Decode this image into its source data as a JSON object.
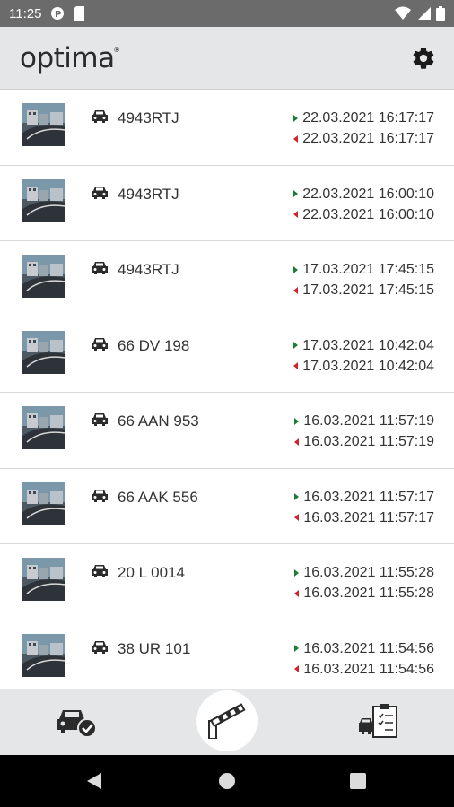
{
  "status_bar": {
    "time": "11:25"
  },
  "header": {
    "logo": "optima",
    "logo_mark": "®"
  },
  "records": [
    {
      "plate": "4943RTJ",
      "entry": "22.03.2021 16:17:17",
      "exit": "22.03.2021 16:17:17"
    },
    {
      "plate": "4943RTJ",
      "entry": "22.03.2021 16:00:10",
      "exit": "22.03.2021 16:00:10"
    },
    {
      "plate": "4943RTJ",
      "entry": "17.03.2021 17:45:15",
      "exit": "17.03.2021 17:45:15"
    },
    {
      "plate": "66 DV 198",
      "entry": "17.03.2021 10:42:04",
      "exit": "17.03.2021 10:42:04"
    },
    {
      "plate": "66 AAN 953",
      "entry": "16.03.2021 11:57:19",
      "exit": "16.03.2021 11:57:19"
    },
    {
      "plate": "66 AAK 556",
      "entry": "16.03.2021 11:57:17",
      "exit": "16.03.2021 11:57:17"
    },
    {
      "plate": "20 L 0014",
      "entry": "16.03.2021 11:55:28",
      "exit": "16.03.2021 11:55:28"
    },
    {
      "plate": "38 UR 101",
      "entry": "16.03.2021 11:54:56",
      "exit": "16.03.2021 11:54:56"
    }
  ],
  "colors": {
    "entry_arrow": "#1d7d35",
    "exit_arrow": "#d3222a",
    "header_bg": "#e5e6e7",
    "status_bg": "#6b6b6b"
  },
  "icons": {
    "header": "gear-icon",
    "bottom_nav": [
      "car-check-icon",
      "barrier-gate-icon",
      "vehicle-report-icon"
    ]
  }
}
